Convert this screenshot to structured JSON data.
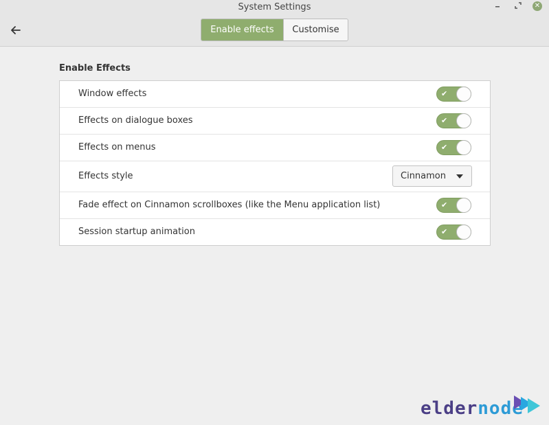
{
  "window": {
    "title": "System Settings",
    "accent": "#8fad6e"
  },
  "header": {
    "back_icon": "arrow-left-icon",
    "tabs": [
      {
        "label": "Enable effects",
        "active": true
      },
      {
        "label": "Customise",
        "active": false
      }
    ]
  },
  "section": {
    "title": "Enable Effects",
    "rows": [
      {
        "label": "Window effects",
        "type": "switch",
        "on": true
      },
      {
        "label": "Effects on dialogue boxes",
        "type": "switch",
        "on": true
      },
      {
        "label": "Effects on menus",
        "type": "switch",
        "on": true
      },
      {
        "label": "Effects style",
        "type": "combo",
        "value": "Cinnamon"
      },
      {
        "label": "Fade effect on Cinnamon scrollboxes (like the Menu application list)",
        "type": "switch",
        "on": true
      },
      {
        "label": "Session startup animation",
        "type": "switch",
        "on": true
      }
    ]
  },
  "watermark": {
    "text_1": "elder",
    "text_2": "node"
  }
}
